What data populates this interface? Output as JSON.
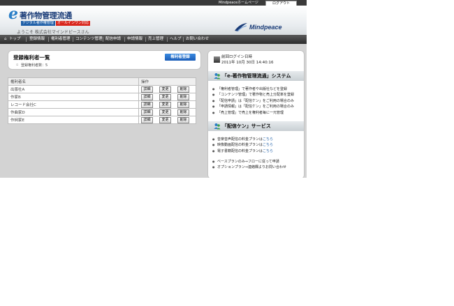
{
  "topbar": {
    "homepage_link": "Mindpeaceホームページ",
    "logout_label": "ログアウト"
  },
  "header": {
    "logo_title": "著作物管理流通",
    "logo_sub1": "デジタル著作権管理",
    "logo_sub2": "オールインワン対応",
    "welcome": "ようこそ 株式会社マインドピースさん",
    "brand": "Mindpeace"
  },
  "nav": {
    "items": [
      "トップ",
      "登録情報",
      "権利者管理",
      "コンテンツ管理",
      "配信申請",
      "申請情報",
      "売上管理",
      "ヘルプ",
      "お問い合わせ"
    ]
  },
  "panel": {
    "title": "登録権利者一覧",
    "count": "登録権利者数：5",
    "register_button": "権利者登録"
  },
  "table": {
    "headers": [
      "権利者名",
      "操作"
    ],
    "rows": [
      {
        "name": "出版社A"
      },
      {
        "name": "作家B"
      },
      {
        "name": "レコード会社C"
      },
      {
        "name": "作曲家D"
      },
      {
        "name": "作詞家E"
      }
    ],
    "actions": {
      "detail": "詳細",
      "change": "変更",
      "delete": "削除"
    }
  },
  "sidebar": {
    "last_login_label": "前回ログイン日時",
    "last_login_value": "2011年 10月 30日 14:40:16",
    "section1": {
      "title": "「e-著作物管理流通」システム",
      "items": [
        "「権利者管理」で著作者や出版社などを登録",
        "「コンテンツ管理」で著作物と売上分配率を登録",
        "「配信申請」は「配信ケン」をご利用の場合のみ",
        "「申請情報」は「配信ケン」をご利用の場合のみ",
        "「売上管理」で売上を権利者毎に一元管理"
      ]
    },
    "section2": {
      "title": "「配信ケン」サービス",
      "items": [
        {
          "text": "音楽音声配信の料金プランは",
          "link": "こちら"
        },
        {
          "text": "映像動画配信の料金プランは",
          "link": "こちら"
        },
        {
          "text": "電子書籍配信の料金プランは",
          "link": "こちら"
        }
      ],
      "items2": [
        {
          "text": "ベースプランのみ⇒フローに従って申請",
          "link": ""
        },
        {
          "text": "オプションプラン⇒連絡欄よりお問い合わせ",
          "link": ""
        }
      ]
    }
  },
  "colors": {
    "accent": "#1e5fa8",
    "nav_bg": "#2c2c2c",
    "page_bg": "#d3d3d3"
  }
}
